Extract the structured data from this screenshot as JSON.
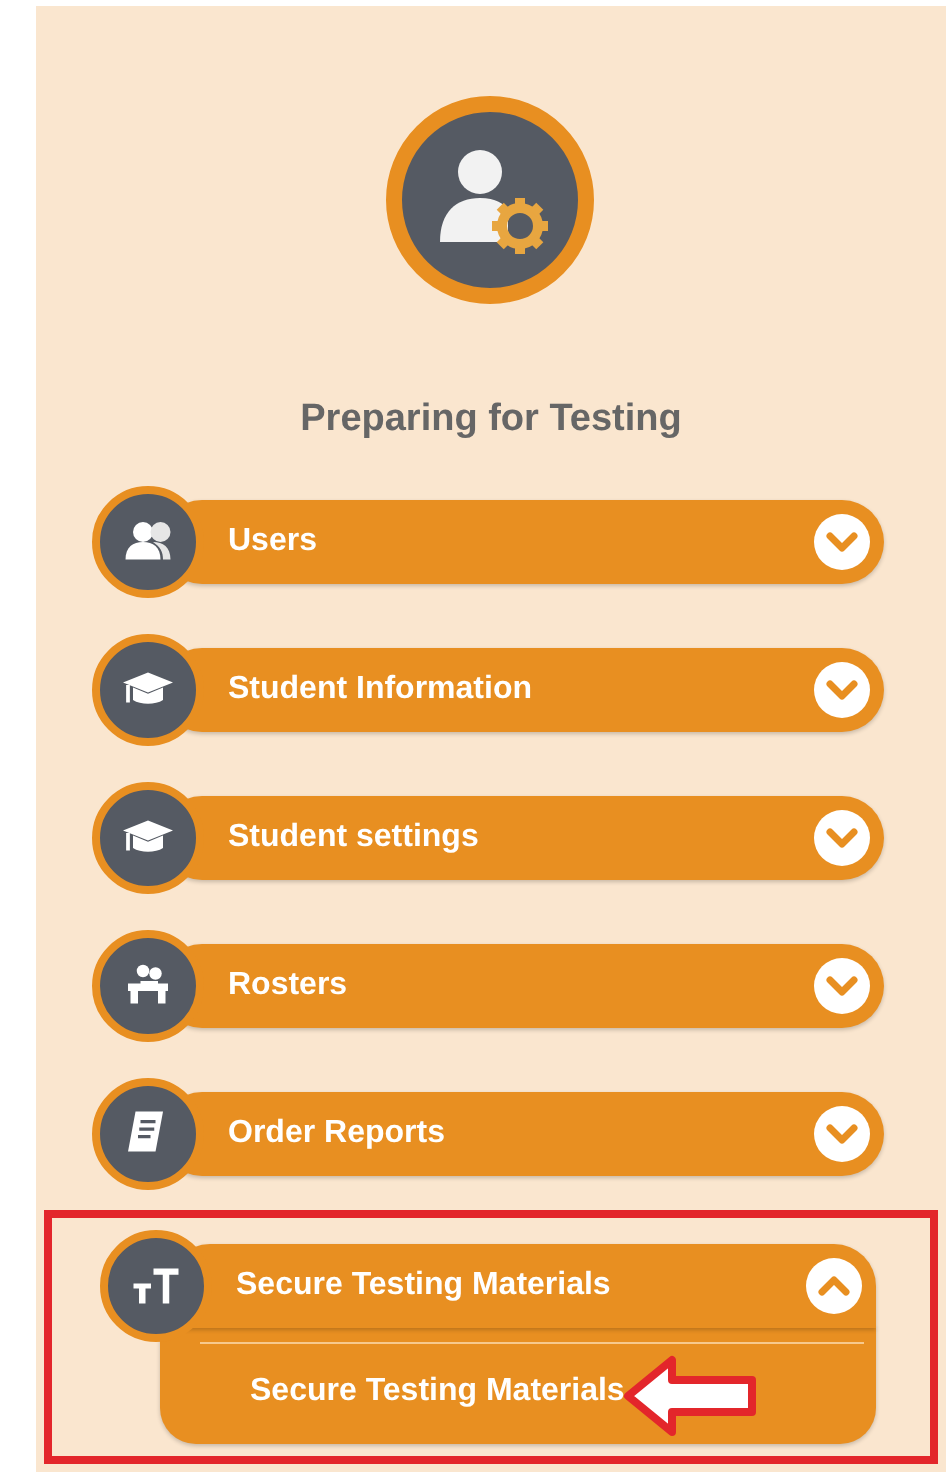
{
  "header": {
    "title": "Preparing for Testing"
  },
  "items": [
    {
      "label": "Users",
      "kind": "users",
      "expanded": false,
      "highlighted": false
    },
    {
      "label": "Student Information",
      "kind": "cap",
      "expanded": false,
      "highlighted": false
    },
    {
      "label": "Student settings",
      "kind": "cap",
      "expanded": false,
      "highlighted": false
    },
    {
      "label": "Rosters",
      "kind": "roster",
      "expanded": false,
      "highlighted": false
    },
    {
      "label": "Order Reports",
      "kind": "report",
      "expanded": false,
      "highlighted": false
    },
    {
      "label": "Secure Testing Materials",
      "kind": "text",
      "expanded": true,
      "highlighted": true,
      "children": [
        {
          "label": "Secure Testing Materials",
          "pointed": true
        }
      ]
    }
  ]
}
